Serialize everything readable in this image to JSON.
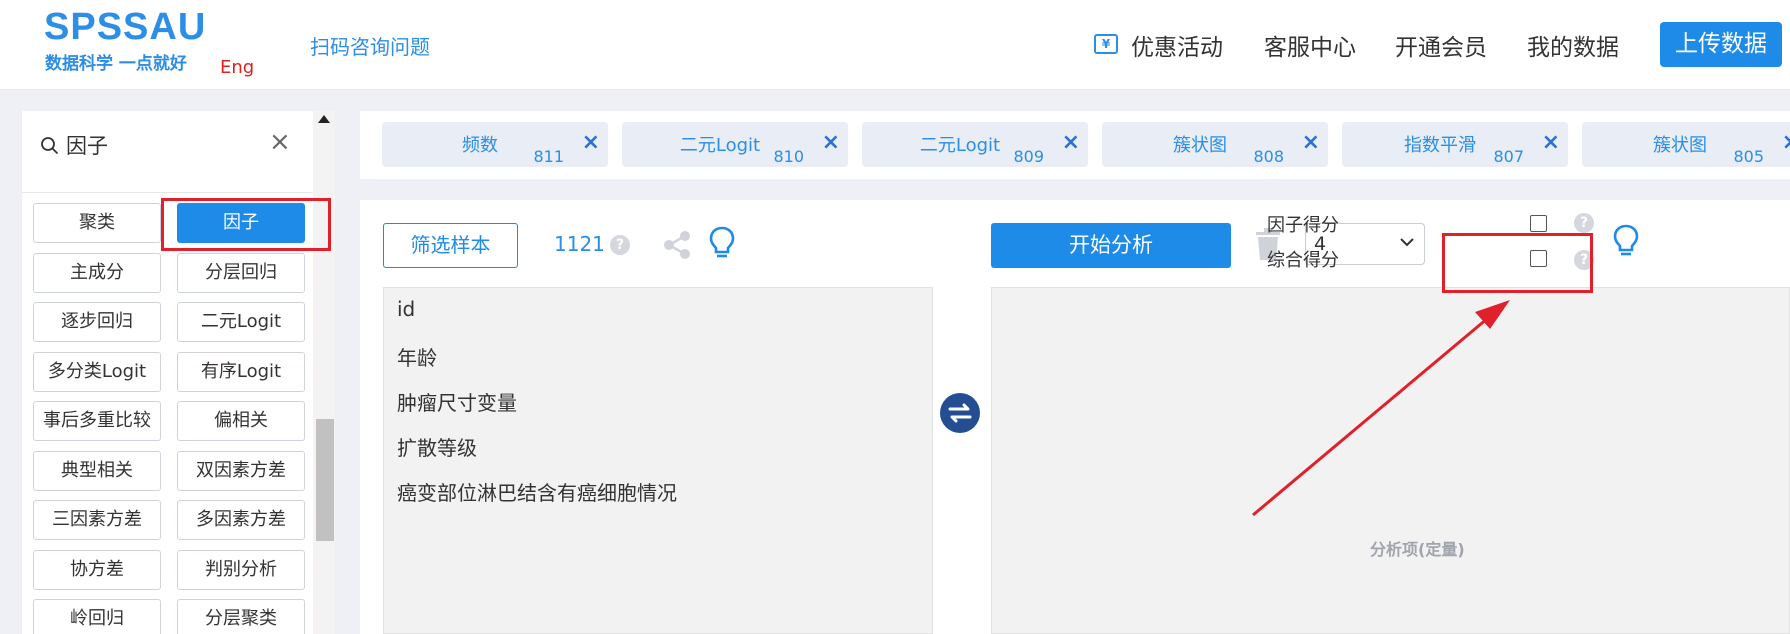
{
  "header": {
    "logo_main": "SPSSAU",
    "logo_sub": "数据科学 一点就好",
    "logo_eng": "Eng",
    "scan_link": "扫码咨询问题",
    "nav": {
      "coupon_icon_glyph": "¥",
      "promotions": "优惠活动",
      "service": "客服中心",
      "membership": "开通会员",
      "my_data": "我的数据",
      "upload": "上传数据"
    }
  },
  "sidebar": {
    "search_value": "因子",
    "clear_glyph": "×",
    "buttons": [
      "聚类",
      "因子",
      "主成分",
      "分层回归",
      "逐步回归",
      "二元Logit",
      "多分类Logit",
      "有序Logit",
      "事后多重比较",
      "偏相关",
      "典型相关",
      "双因素方差",
      "三因素方差",
      "多因素方差",
      "协方差",
      "判别分析",
      "岭回归",
      "分层聚类"
    ],
    "active_index": 1
  },
  "tabs": [
    {
      "name": "频数",
      "num": "811"
    },
    {
      "name": "二元Logit",
      "num": "810"
    },
    {
      "name": "二元Logit",
      "num": "809"
    },
    {
      "name": "簇状图",
      "num": "808"
    },
    {
      "name": "指数平滑",
      "num": "807"
    },
    {
      "name": "簇状图",
      "num": "805"
    }
  ],
  "tab_close_glyph": "×",
  "main": {
    "filter_button": "筛选样本",
    "sample_count": "1121",
    "help_glyph": "?",
    "variables": [
      "id",
      "年龄",
      "肿瘤尺寸变量",
      "扩散等级",
      "癌变部位淋巴结含有癌细胞情况"
    ],
    "start_button": "开始分析",
    "factor_count": "4",
    "factor_score_label": "因子得分",
    "composite_score_label": "综合得分",
    "drop_hint": "分析项(定量)"
  },
  "colors": {
    "accent": "#1e8be8",
    "highlight": "#e0202a",
    "background": "#eef0f5"
  }
}
